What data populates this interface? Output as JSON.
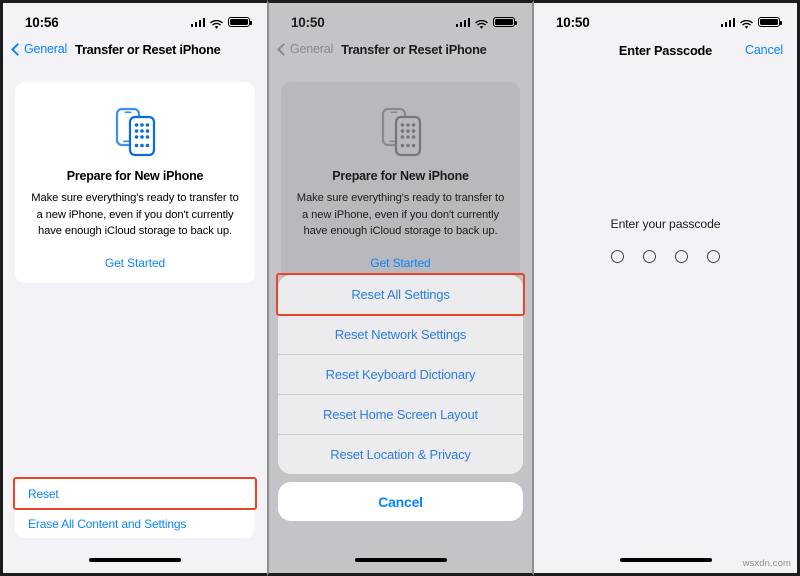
{
  "panels": [
    {
      "id": "transfer-or-reset-iphone",
      "status": {
        "time": "10:56",
        "signal_icon": "cellular-signal-icon",
        "wifi_icon": "wifi-icon",
        "battery_icon": "battery-icon"
      },
      "nav": {
        "back_label": "General",
        "title": "Transfer or Reset iPhone",
        "back_icon": "chevron-left-icon"
      },
      "card": {
        "icon": "two-iphones-icon",
        "title": "Prepare for New iPhone",
        "body": "Make sure everything's ready to transfer to a new iPhone, even if you don't currently have enough iCloud storage to back up.",
        "link": "Get Started"
      },
      "bottom_rows": [
        {
          "label": "Reset",
          "highlighted": true
        },
        {
          "label": "Erase All Content and Settings",
          "highlighted": false
        }
      ]
    },
    {
      "id": "transfer-or-reset-iphone-dimmed",
      "status": {
        "time": "10:50",
        "signal_icon": "cellular-signal-icon",
        "wifi_icon": "wifi-icon",
        "battery_icon": "battery-icon"
      },
      "nav": {
        "back_label": "General",
        "title": "Transfer or Reset iPhone",
        "back_icon": "chevron-left-icon"
      },
      "card": {
        "icon": "two-iphones-icon",
        "title": "Prepare for New iPhone",
        "body": "Make sure everything's ready to transfer to a new iPhone, even if you don't currently have enough iCloud storage to back up.",
        "link": "Get Started"
      },
      "sheet": {
        "options": [
          {
            "label": "Reset All Settings",
            "highlighted": true
          },
          {
            "label": "Reset Network Settings",
            "highlighted": false
          },
          {
            "label": "Reset Keyboard Dictionary",
            "highlighted": false
          },
          {
            "label": "Reset Home Screen Layout",
            "highlighted": false
          },
          {
            "label": "Reset Location & Privacy",
            "highlighted": false
          }
        ],
        "cancel": "Cancel"
      }
    },
    {
      "id": "enter-passcode",
      "status": {
        "time": "10:50",
        "signal_icon": "cellular-signal-icon",
        "wifi_icon": "wifi-icon",
        "battery_icon": "battery-icon"
      },
      "nav": {
        "title": "Enter Passcode",
        "cancel": "Cancel"
      },
      "passcode": {
        "prompt": "Enter your passcode",
        "digits": 4,
        "filled": 0
      }
    }
  ],
  "watermark": "wsxdn.com",
  "colors": {
    "accent_blue": "#0a84ff",
    "highlight_red": "#e8452a",
    "panel_bg": "#f2f2f7",
    "dimmed_bg": "#c4c4c8"
  }
}
